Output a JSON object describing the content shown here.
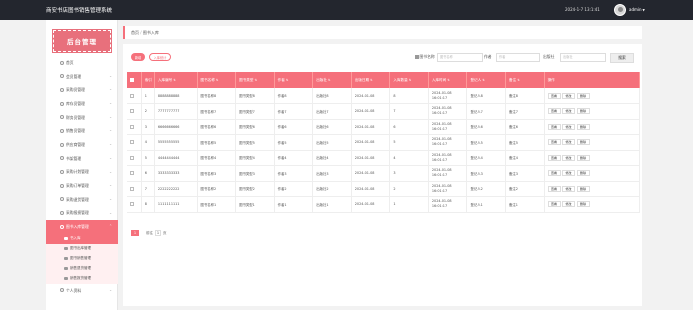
{
  "header": {
    "title": "商安书店图书销售管理系统",
    "datetime": "2024-1-7 13:1:41",
    "username": "admin",
    "dropdown_caret": "▼"
  },
  "sidebar": {
    "logo": "后台管理",
    "items": [
      {
        "label": "首页",
        "icon": "home-icon",
        "caret": ""
      },
      {
        "label": "会员管理",
        "icon": "user-icon",
        "caret": "⌄"
      },
      {
        "label": "采购员管理",
        "icon": "user-icon",
        "caret": "⌄"
      },
      {
        "label": "库存员管理",
        "icon": "user-icon",
        "caret": "⌄"
      },
      {
        "label": "财务员管理",
        "icon": "user-icon",
        "caret": "⌄"
      },
      {
        "label": "销售员管理",
        "icon": "user-icon",
        "caret": "⌄"
      },
      {
        "label": "供应商管理",
        "icon": "user-icon",
        "caret": "⌄"
      },
      {
        "label": "书架管理",
        "icon": "shelf-icon",
        "caret": "⌄"
      },
      {
        "label": "采购计划管理",
        "icon": "list-icon",
        "caret": "⌄"
      },
      {
        "label": "采购订单管理",
        "icon": "list-icon",
        "caret": "⌄"
      },
      {
        "label": "采购退货管理",
        "icon": "list-icon",
        "caret": "⌄"
      },
      {
        "label": "采购报损管理",
        "icon": "list-icon",
        "caret": "⌄"
      }
    ],
    "active_item": {
      "label": "图书入库管理",
      "icon": "book-icon",
      "caret": "⌃"
    },
    "sub_items": [
      {
        "label": "书入库",
        "current": true
      },
      {
        "label": "图书出库管理"
      },
      {
        "label": "图书销售管理"
      },
      {
        "label": "销售退货管理"
      },
      {
        "label": "销售报货管理"
      }
    ],
    "last_item": {
      "label": "个人资料",
      "icon": "user-icon",
      "caret": "⌄"
    }
  },
  "breadcrumb": {
    "home": "首页",
    "separator": "/",
    "current": "图书入库"
  },
  "toolbar": {
    "tab_first": "新增",
    "tab_second": "入库统计",
    "filters": [
      {
        "label": "图书名称",
        "placeholder": "图书名称"
      },
      {
        "label": "作者",
        "placeholder": "作者"
      },
      {
        "label": "出版社",
        "placeholder": "出版社"
      }
    ],
    "search_button": "搜索"
  },
  "table": {
    "sort_glyph": "⇅",
    "columns": [
      "索引",
      "入库编号",
      "图书名称",
      "图书类型",
      "作者",
      "出版社",
      "出版日期",
      "入库数量",
      "入库时间",
      "登记人",
      "备注",
      "操作"
    ],
    "rows": [
      {
        "index": "1",
        "code": "8888888888",
        "name": "图书名称8",
        "type": "图书类型8",
        "author": "作者8",
        "press": "出版社8",
        "pub_date": "2024-01-08",
        "qty": "8",
        "time": "2024-01-08 16:01:17",
        "registrar": "登记人8",
        "remark": "备注8"
      },
      {
        "index": "2",
        "code": "7777777777",
        "name": "图书名称7",
        "type": "图书类型7",
        "author": "作者7",
        "press": "出版社7",
        "pub_date": "2024-01-08",
        "qty": "7",
        "time": "2024-01-08 16:01:17",
        "registrar": "登记人7",
        "remark": "备注7"
      },
      {
        "index": "3",
        "code": "6666666666",
        "name": "图书名称6",
        "type": "图书类型6",
        "author": "作者6",
        "press": "出版社6",
        "pub_date": "2024-01-08",
        "qty": "6",
        "time": "2024-01-08 16:01:17",
        "registrar": "登记人6",
        "remark": "备注6"
      },
      {
        "index": "4",
        "code": "5555555555",
        "name": "图书名称5",
        "type": "图书类型5",
        "author": "作者5",
        "press": "出版社5",
        "pub_date": "2024-01-08",
        "qty": "5",
        "time": "2024-01-08 16:01:17",
        "registrar": "登记人5",
        "remark": "备注5"
      },
      {
        "index": "5",
        "code": "4444444444",
        "name": "图书名称4",
        "type": "图书类型4",
        "author": "作者4",
        "press": "出版社4",
        "pub_date": "2024-01-08",
        "qty": "4",
        "time": "2024-01-08 16:01:17",
        "registrar": "登记人4",
        "remark": "备注4"
      },
      {
        "index": "6",
        "code": "3333333333",
        "name": "图书名称3",
        "type": "图书类型3",
        "author": "作者3",
        "press": "出版社3",
        "pub_date": "2024-01-08",
        "qty": "3",
        "time": "2024-01-08 16:01:17",
        "registrar": "登记人3",
        "remark": "备注3"
      },
      {
        "index": "7",
        "code": "2222222222",
        "name": "图书名称2",
        "type": "图书类型2",
        "author": "作者2",
        "press": "出版社2",
        "pub_date": "2024-01-08",
        "qty": "2",
        "time": "2024-01-08 16:01:17",
        "registrar": "登记人2",
        "remark": "备注2"
      },
      {
        "index": "8",
        "code": "1111111111",
        "name": "图书名称1",
        "type": "图书类型1",
        "author": "作者1",
        "press": "出版社1",
        "pub_date": "2024-01-08",
        "qty": "1",
        "time": "2024-01-08 16:01:17",
        "registrar": "登记人1",
        "remark": "备注1"
      }
    ],
    "actions": [
      "查看",
      "修改",
      "删除"
    ]
  },
  "pagination": {
    "current_page": "1",
    "goto_label": "前往",
    "goto_value": "1",
    "page_unit": "页"
  },
  "colors": {
    "accent": "#f5707b",
    "topbar": "#23262e",
    "logo_bg": "#e8707c"
  }
}
